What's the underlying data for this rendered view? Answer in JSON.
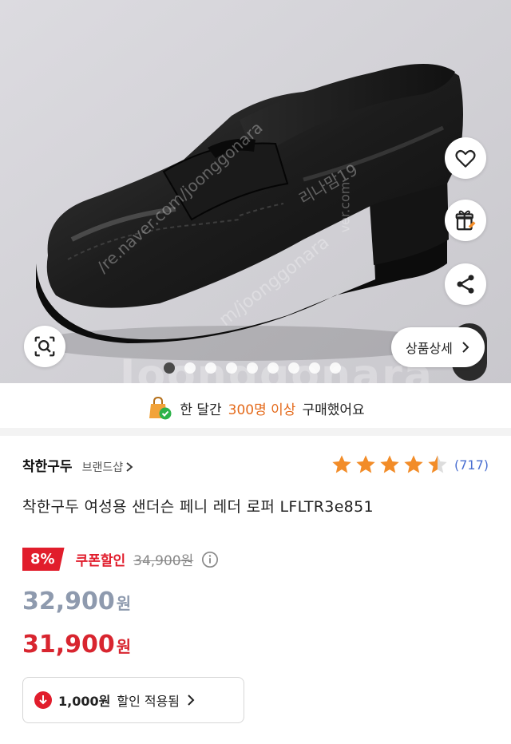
{
  "hero": {
    "watermarks": [
      "Joonggonara",
      "/re.naver.com/joonggonara",
      "리나맘19",
      "m/joonggonara",
      "ver.com"
    ],
    "icons": [
      "heart-icon",
      "gift-icon",
      "share-icon",
      "lens-search-icon"
    ],
    "detail_button_label": "상품상세",
    "slide_count": 9,
    "active_slide": 1
  },
  "banner": {
    "prefix": "한 달간",
    "highlight": "300명 이상",
    "suffix": "구매했어요"
  },
  "product": {
    "brand_name": "착한구두",
    "brand_shop_label": "브랜드샵",
    "rating_stars": 4.5,
    "review_count": "(717)",
    "title": "착한구두 여성용 샌더슨 페니 레더 로퍼 LFLTR3e851",
    "discount_percent": "8%",
    "coupon_label": "쿠폰할인",
    "original_price": "34,900원",
    "price_after_discount": "32,900",
    "price_final": "31,900",
    "won_unit": "원",
    "applied_amount": "1,000원",
    "applied_text": "할인 적용됨"
  },
  "colors": {
    "accent_red": "#e11d2c",
    "banner_highlight": "#e46a1b",
    "star_orange": "#f28c28",
    "review_blue": "#4a6fd1"
  }
}
